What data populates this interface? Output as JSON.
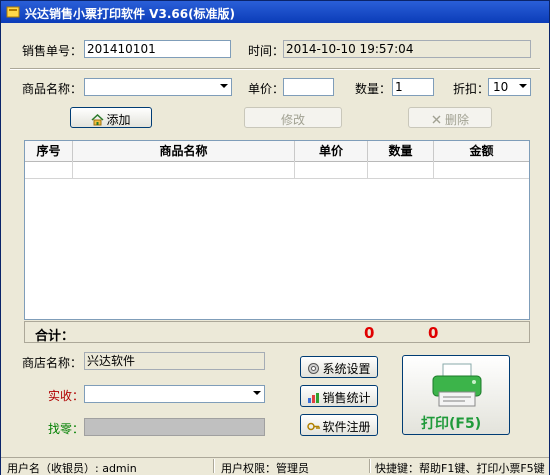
{
  "window": {
    "title": "兴达销售小票打印软件 V3.66(标准版)"
  },
  "header": {
    "order_no_label": "销售单号：",
    "order_no_value": "201410101",
    "time_label": "时间：",
    "time_value": "2014-10-10 19:57:04"
  },
  "entry": {
    "product_label": "商品名称：",
    "product_value": "",
    "price_label": "单价：",
    "price_value": "",
    "qty_label": "数量：",
    "qty_value": "1",
    "discount_label": "折扣：",
    "discount_value": "10"
  },
  "actions": {
    "add": "添加",
    "edit": "修改",
    "delete": "删除"
  },
  "table": {
    "columns": [
      "序号",
      "商品名称",
      "单价",
      "数量",
      "金额"
    ],
    "rows": []
  },
  "totals": {
    "label": "合计：",
    "qty_total": "0",
    "amount_total": "0"
  },
  "bottom": {
    "shop_label": "商店名称：",
    "shop_value": "兴达软件",
    "received_label": "实收：",
    "received_value": "",
    "change_label": "找零：",
    "change_value": "",
    "settings_button": "系统设置",
    "stats_button": "销售统计",
    "register_button": "软件注册",
    "print_button": "打印(F5)"
  },
  "statusbar": {
    "user": "用户名（收银员）: admin",
    "role": "用户权限：管理员",
    "shortcut": "快捷键：帮助F1键、打印小票F5键"
  },
  "colors": {
    "title_bar": "#1d4fc9",
    "received_label": "#b00000",
    "change_label": "#008000",
    "totals_red": "#e00000",
    "print_green": "#1f9a3a",
    "change_field": "#c0c0c0"
  }
}
